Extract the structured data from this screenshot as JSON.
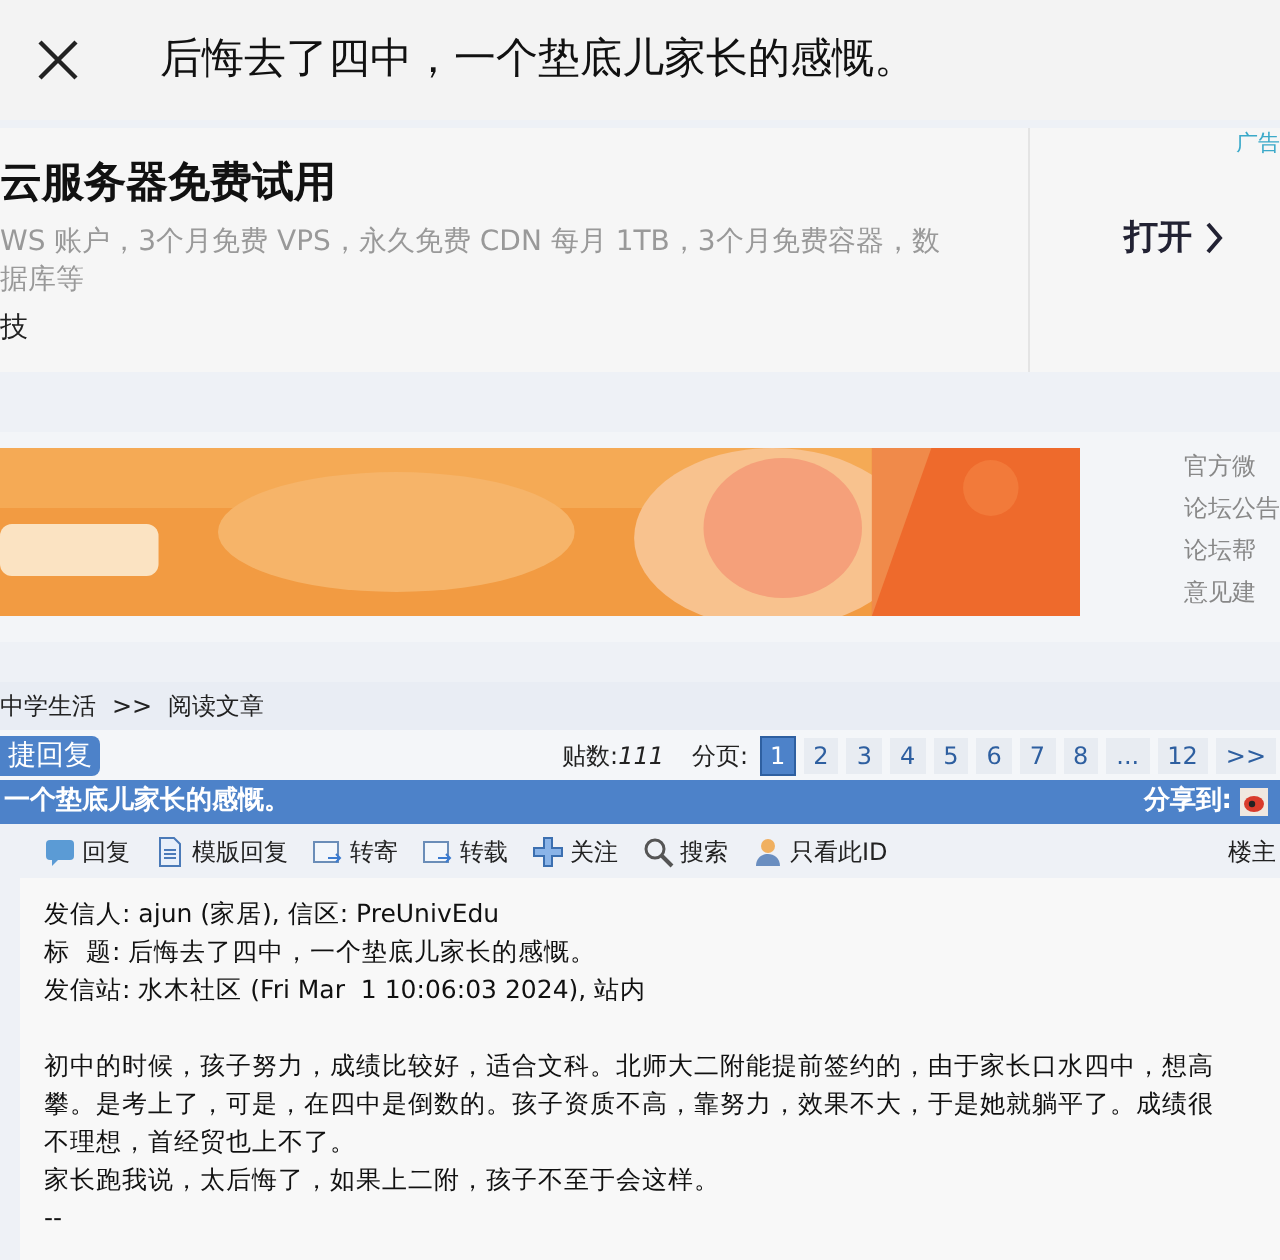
{
  "header": {
    "title": "后悔去了四中，一个垫底儿家长的感慨。"
  },
  "ad": {
    "title": "云服务器免费试用",
    "description": "WS 账户，3个月免费 VPS，永久免费 CDN 每月 1TB，3个月免费容器，数据库等",
    "source": "技",
    "badge": "广告",
    "action": "打开"
  },
  "banner": {
    "kind": "picture"
  },
  "side_links": [
    "官方微",
    "论坛公告",
    "论坛帮",
    "意见建"
  ],
  "breadcrumb": [
    "中学生活",
    ">>",
    "阅读文章"
  ],
  "quick_reply": "捷回复",
  "post_count_label": "贴数:",
  "post_count": "111",
  "pages_label": "分页:",
  "pages": [
    {
      "label": "1",
      "selected": true
    },
    {
      "label": "2",
      "selected": false
    },
    {
      "label": "3",
      "selected": false
    },
    {
      "label": "4",
      "selected": false
    },
    {
      "label": "5",
      "selected": false
    },
    {
      "label": "6",
      "selected": false
    },
    {
      "label": "7",
      "selected": false
    },
    {
      "label": "8",
      "selected": false
    },
    {
      "label": "...",
      "selected": false
    },
    {
      "label": "12",
      "selected": false
    },
    {
      "label": ">>",
      "selected": false
    }
  ],
  "topic_bar": {
    "title": "一个垫底儿家长的感慨。",
    "share_label": "分享到:"
  },
  "actions": [
    {
      "kind": "reply",
      "label": "回复"
    },
    {
      "kind": "template",
      "label": "模版回复"
    },
    {
      "kind": "forward",
      "label": "转寄"
    },
    {
      "kind": "repost",
      "label": "转载"
    },
    {
      "kind": "follow",
      "label": "关注"
    },
    {
      "kind": "search",
      "label": "搜索"
    },
    {
      "kind": "author",
      "label": "只看此ID"
    }
  ],
  "floor_label": "楼主",
  "post": {
    "headers": [
      "发信人: ajun (家居), 信区: PreUnivEdu",
      "标  题: 后悔去了四中，一个垫底儿家长的感慨。",
      "发信站: 水木社区 (Fri Mar  1 10:06:03 2024), 站内"
    ],
    "paragraphs": [
      "初中的时候，孩子努力，成绩比较好，适合文科。北师大二附能提前签约的，由于家长口水四中，想高攀。是考上了，可是，在四中是倒数的。孩子资质不高，靠努力，效果不大，于是她就躺平了。成绩很不理想，首经贸也上不了。",
      "家长跑我说，太后悔了，如果上二附，孩子不至于会这样。"
    ],
    "signature": "--"
  }
}
